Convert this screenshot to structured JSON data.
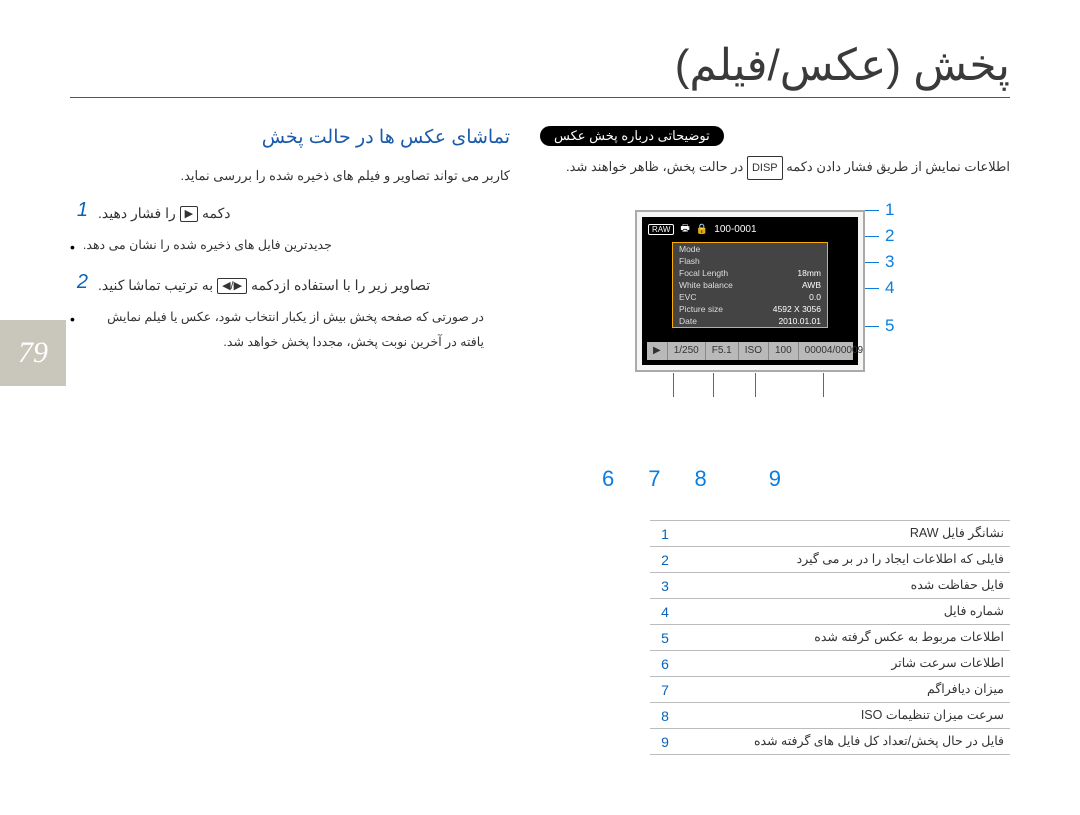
{
  "page_number": "79",
  "title": "پخش (عکس/فیلم)",
  "right_col": {
    "heading": "تماشای عکس ها در حالت پخش",
    "intro": "کاربر می تواند تصاویر و فیلم های ذخیره شده را بررسی نماید.",
    "steps": [
      {
        "num": "1",
        "prefix": "دکمه",
        "icon_glyph": "▶",
        "suffix": "را فشار دهید.",
        "bullets": [
          "جدیدترین فایل های ذخیره شده را نشان می دهد."
        ]
      },
      {
        "num": "2",
        "prefix": "تصاویر زیر را با استفاده ازدکمه",
        "icon_glyph": "◀/▶",
        "suffix": "به ترتیب تماشا کنید.",
        "bullets": [
          "در صورتی که صفحه پخش بیش از یکبار انتخاب شود، عکس یا فیلم نمایش یافته در آخرین نوبت پخش، مجددا پخش خواهد شد."
        ]
      }
    ]
  },
  "left_col": {
    "pill": "توضیحاتی درباره پخش عکس",
    "body_prefix": "اطلاعات نمایش از طریق فشار دادن دکمه",
    "disp": "DISP",
    "body_suffix": "در حالت پخش، ظاهر خواهند شد."
  },
  "lcd": {
    "top_file": "100-0001",
    "raw_tag": "RAW",
    "info": [
      {
        "k": "Mode",
        "v": ""
      },
      {
        "k": "Flash",
        "v": ""
      },
      {
        "k": "Focal Length",
        "v": "18mm"
      },
      {
        "k": "White balance",
        "v": "AWB"
      },
      {
        "k": "EVC",
        "v": "0.0"
      },
      {
        "k": "Picture size",
        "v": "4592 X 3056"
      },
      {
        "k": "Date",
        "v": "2010.01.01"
      }
    ],
    "bottom": {
      "play": "▶",
      "shutter": "1/250",
      "fnum": "F5.1",
      "iso_label": "ISO",
      "iso_val": "100",
      "counter": "00004/00009"
    },
    "right_nums": [
      "1",
      "2",
      "3",
      "4",
      "5"
    ],
    "bottom_nums": [
      "6",
      "7",
      "8",
      "9"
    ]
  },
  "legend": [
    {
      "idx": "1",
      "txt": "نشانگر فایل RAW"
    },
    {
      "idx": "2",
      "txt": "فایلی که اطلاعات ایجاد را در بر می گیرد"
    },
    {
      "idx": "3",
      "txt": "فایل حفاظت شده"
    },
    {
      "idx": "4",
      "txt": "شماره فایل"
    },
    {
      "idx": "5",
      "txt": "اطلاعات مربوط به عکس گرفته شده"
    },
    {
      "idx": "6",
      "txt": "اطلاعات سرعت شاتر"
    },
    {
      "idx": "7",
      "txt": "میزان دیافراگم"
    },
    {
      "idx": "8",
      "txt": "سرعت میزان تنظیمات ISO"
    },
    {
      "idx": "9",
      "txt": "فایل در حال پخش/تعداد کل فایل های گرفته شده"
    }
  ]
}
